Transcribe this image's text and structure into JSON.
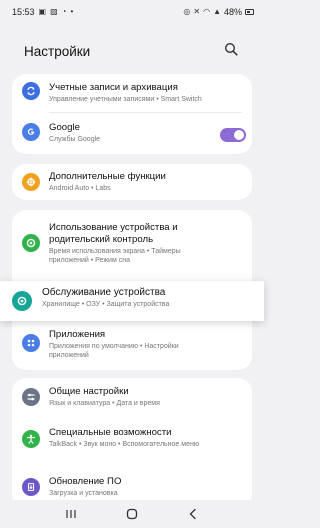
{
  "status_bar": {
    "time": "15:53",
    "battery": "48%",
    "left_icons": [
      "sim-icon",
      "gallery-icon",
      "wifi-calling-icon",
      "notification-dot-icon"
    ],
    "right_icons": [
      "data-saver-icon",
      "mute-icon",
      "wifi-icon",
      "signal-icon",
      "battery-icon"
    ]
  },
  "header": {
    "title": "Настройки",
    "search_icon": "search-icon"
  },
  "items": [
    {
      "title": "Учетные записи и архивация",
      "subtitle": "Управление учетными записями • Smart Switch",
      "icon": "sync-icon",
      "color": "#3d6fe0"
    },
    {
      "title": "Google",
      "subtitle": "Службы Google",
      "icon": "google-g-icon",
      "color": "#4a7de6",
      "toggle_on": true
    },
    {
      "title": "Дополнительные функции",
      "subtitle": "Android Auto • Labs",
      "icon": "plus-gear-icon",
      "color": "#f0a21f"
    },
    {
      "title": "Использование устройства и",
      "title2": "родительский контроль",
      "subtitle": "Время использования экрана • Таймеры",
      "subtitle2": "приложений • Режим сна",
      "icon": "digital-wellbeing-icon",
      "color": "#2fb34a"
    },
    {
      "title": "Обслуживание устройства",
      "subtitle": "Хранилище • ОЗУ • Защита устройства",
      "icon": "device-care-icon",
      "color": "#16a596"
    },
    {
      "title": "Приложения",
      "subtitle": "Приложения по умолчанию • Настройки",
      "subtitle2": "приложений",
      "icon": "apps-grid-icon",
      "color": "#4a7de6"
    },
    {
      "title": "Общие настройки",
      "subtitle": "Язык и клавиатура • Дата и время",
      "icon": "sliders-icon",
      "color": "#6b7386"
    },
    {
      "title": "Специальные возможности",
      "subtitle": "TalkBack • Звук моно • Вспомогательное меню",
      "icon": "accessibility-icon",
      "color": "#2fb34a"
    },
    {
      "title": "Обновление ПО",
      "subtitle": "Загрузка и установка",
      "icon": "software-update-icon",
      "color": "#6e57c9"
    }
  ],
  "nav": {
    "recents": "recents-icon",
    "home": "home-icon",
    "back": "back-icon"
  }
}
